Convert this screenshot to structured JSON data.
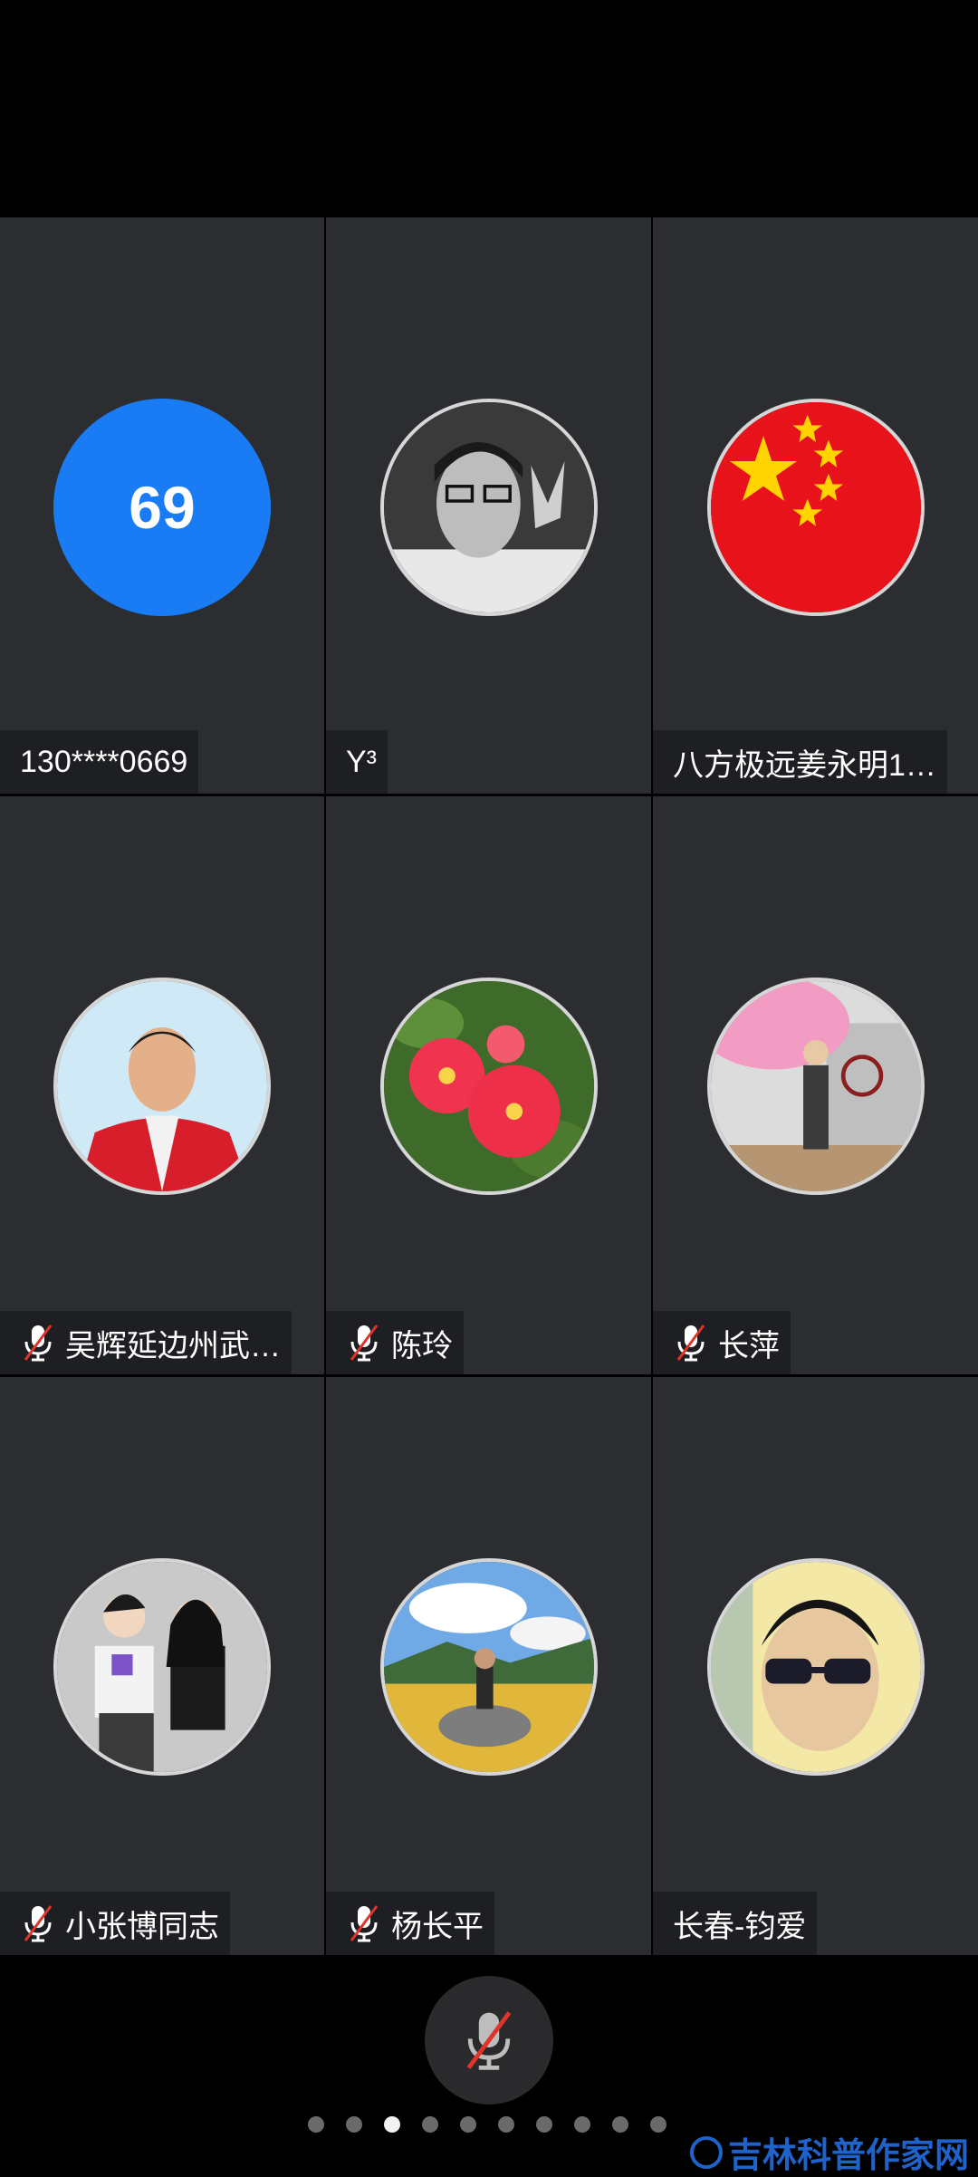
{
  "participants": [
    {
      "name": "130****0669",
      "avatar_text": "69",
      "muted": false
    },
    {
      "name": "Y³",
      "muted": false
    },
    {
      "name": "八方极远姜永明1…",
      "muted": false
    },
    {
      "name": "吴辉延边州武…",
      "muted": true
    },
    {
      "name": "陈玲",
      "muted": true
    },
    {
      "name": "长萍",
      "muted": true
    },
    {
      "name": "小张博同志",
      "muted": true
    },
    {
      "name": "杨长平",
      "muted": true
    },
    {
      "name": "长春-钧爱",
      "muted": false
    }
  ],
  "icons": {
    "muted": "mic-off-icon",
    "mic_button": "mic-off-icon"
  },
  "pager": {
    "pages": 10,
    "current": 3
  },
  "watermark": "吉林科普作家网",
  "colors": {
    "tile": "#2b2d31",
    "badge": "#1a7cf5",
    "mute_slash": "#e0342b"
  }
}
